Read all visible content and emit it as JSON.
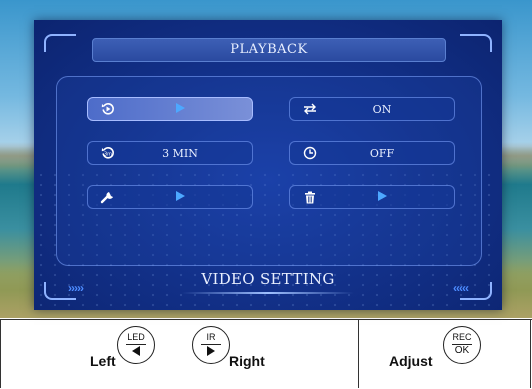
{
  "osd": {
    "title": "PLAYBACK",
    "footer_title": "VIDEO SETTING",
    "chevrons_left": "›››››",
    "chevrons_right": "‹‹‹‹‹",
    "items": [
      {
        "icon": "playback-icon",
        "value": "",
        "control": "arrow",
        "selected": true
      },
      {
        "icon": "loop-record-icon",
        "value": "ON",
        "control": "text",
        "selected": false
      },
      {
        "icon": "record-duration-icon",
        "value": "3 MIN",
        "control": "text",
        "selected": false
      },
      {
        "icon": "timer-icon",
        "value": "OFF",
        "control": "text",
        "selected": false
      },
      {
        "icon": "wrench-icon",
        "value": "",
        "control": "arrow",
        "selected": false
      },
      {
        "icon": "trash-icon",
        "value": "",
        "control": "arrow",
        "selected": false
      }
    ],
    "colors": {
      "accent": "#4da8ff",
      "panel": "#13328c"
    }
  },
  "controls": {
    "left_button": {
      "top": "LED",
      "label": "Left"
    },
    "right_button": {
      "top": "IR",
      "label": "Right"
    },
    "adjust_button": {
      "top": "REC",
      "bottom": "OK",
      "label": "Adjust"
    }
  }
}
